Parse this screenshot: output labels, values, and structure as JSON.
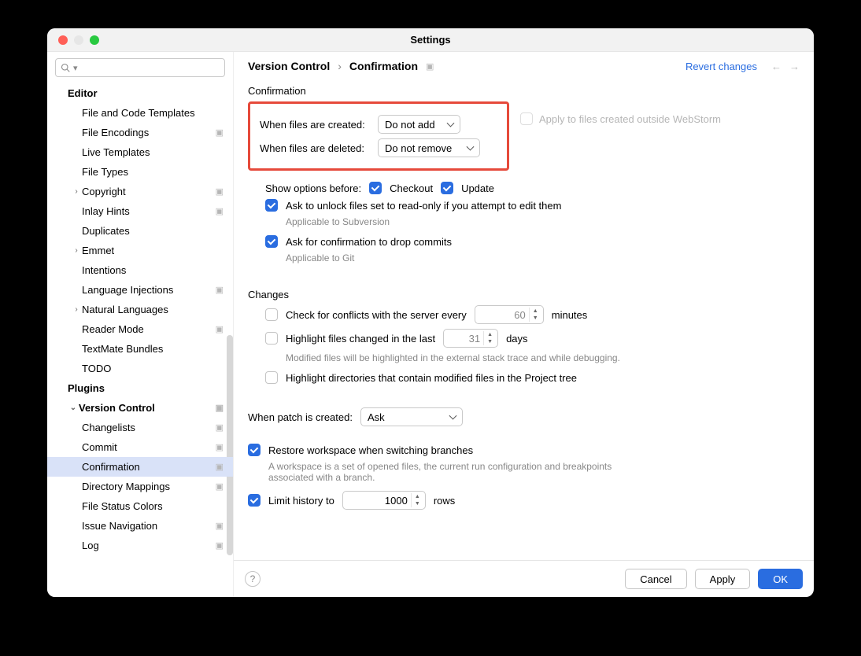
{
  "window": {
    "title": "Settings"
  },
  "header": {
    "breadcrumb_root": "Version Control",
    "breadcrumb_sep": "›",
    "breadcrumb_leaf": "Confirmation",
    "revert": "Revert changes"
  },
  "sidebar": {
    "items": [
      {
        "label": "Editor",
        "depth": 0,
        "chev": "",
        "overlay": false,
        "selected": false
      },
      {
        "label": "File and Code Templates",
        "depth": 1,
        "chev": "",
        "overlay": false,
        "selected": false
      },
      {
        "label": "File Encodings",
        "depth": 1,
        "chev": "",
        "overlay": true,
        "selected": false
      },
      {
        "label": "Live Templates",
        "depth": 1,
        "chev": "",
        "overlay": false,
        "selected": false
      },
      {
        "label": "File Types",
        "depth": 1,
        "chev": "",
        "overlay": false,
        "selected": false
      },
      {
        "label": "Copyright",
        "depth": 1,
        "chev": ">",
        "overlay": true,
        "selected": false
      },
      {
        "label": "Inlay Hints",
        "depth": 1,
        "chev": "",
        "overlay": true,
        "selected": false
      },
      {
        "label": "Duplicates",
        "depth": 1,
        "chev": "",
        "overlay": false,
        "selected": false
      },
      {
        "label": "Emmet",
        "depth": 1,
        "chev": ">",
        "overlay": false,
        "selected": false
      },
      {
        "label": "Intentions",
        "depth": 1,
        "chev": "",
        "overlay": false,
        "selected": false
      },
      {
        "label": "Language Injections",
        "depth": 1,
        "chev": "",
        "overlay": true,
        "selected": false
      },
      {
        "label": "Natural Languages",
        "depth": 1,
        "chev": ">",
        "overlay": false,
        "selected": false
      },
      {
        "label": "Reader Mode",
        "depth": 1,
        "chev": "",
        "overlay": true,
        "selected": false
      },
      {
        "label": "TextMate Bundles",
        "depth": 1,
        "chev": "",
        "overlay": false,
        "selected": false
      },
      {
        "label": "TODO",
        "depth": 1,
        "chev": "",
        "overlay": false,
        "selected": false
      },
      {
        "label": "Plugins",
        "depth": 0,
        "chev": "",
        "overlay": false,
        "selected": false
      },
      {
        "label": "Version Control",
        "depth": 0,
        "chev": "v",
        "overlay": true,
        "selected": false
      },
      {
        "label": "Changelists",
        "depth": 1,
        "chev": "",
        "overlay": true,
        "selected": false
      },
      {
        "label": "Commit",
        "depth": 1,
        "chev": "",
        "overlay": true,
        "selected": false
      },
      {
        "label": "Confirmation",
        "depth": 1,
        "chev": "",
        "overlay": true,
        "selected": true
      },
      {
        "label": "Directory Mappings",
        "depth": 1,
        "chev": "",
        "overlay": true,
        "selected": false
      },
      {
        "label": "File Status Colors",
        "depth": 1,
        "chev": "",
        "overlay": false,
        "selected": false
      },
      {
        "label": "Issue Navigation",
        "depth": 1,
        "chev": "",
        "overlay": true,
        "selected": false
      },
      {
        "label": "Log",
        "depth": 1,
        "chev": "",
        "overlay": true,
        "selected": false
      }
    ]
  },
  "confirmation": {
    "section_title": "Confirmation",
    "created_label": "When files are created:",
    "created_value": "Do not add",
    "apply_outside_label": "Apply to files created outside WebStorm",
    "deleted_label": "When files are deleted:",
    "deleted_value": "Do not remove",
    "show_before_label": "Show options before:",
    "show_before_checkout": "Checkout",
    "show_before_update": "Update",
    "unlock_label": "Ask to unlock files set to read-only if you attempt to edit them",
    "unlock_desc": "Applicable to Subversion",
    "drop_commits_label": "Ask for confirmation to drop commits",
    "drop_commits_desc": "Applicable to Git"
  },
  "changes": {
    "section_title": "Changes",
    "conflicts_label": "Check for conflicts with the server every",
    "conflicts_value": "60",
    "conflicts_unit": "minutes",
    "highlight_files_label": "Highlight files changed in the last",
    "highlight_files_value": "31",
    "highlight_files_unit": "days",
    "highlight_files_desc": "Modified files will be highlighted in the external stack trace and while debugging.",
    "highlight_dirs_label": "Highlight directories that contain modified files in the Project tree"
  },
  "patch": {
    "label": "When patch is created:",
    "value": "Ask"
  },
  "restore": {
    "label": "Restore workspace when switching branches",
    "desc": "A workspace is a set of opened files, the current run configuration and breakpoints associated with a branch."
  },
  "limit_history": {
    "label": "Limit history to",
    "value": "1000",
    "unit": "rows"
  },
  "footer": {
    "cancel": "Cancel",
    "apply": "Apply",
    "ok": "OK"
  }
}
